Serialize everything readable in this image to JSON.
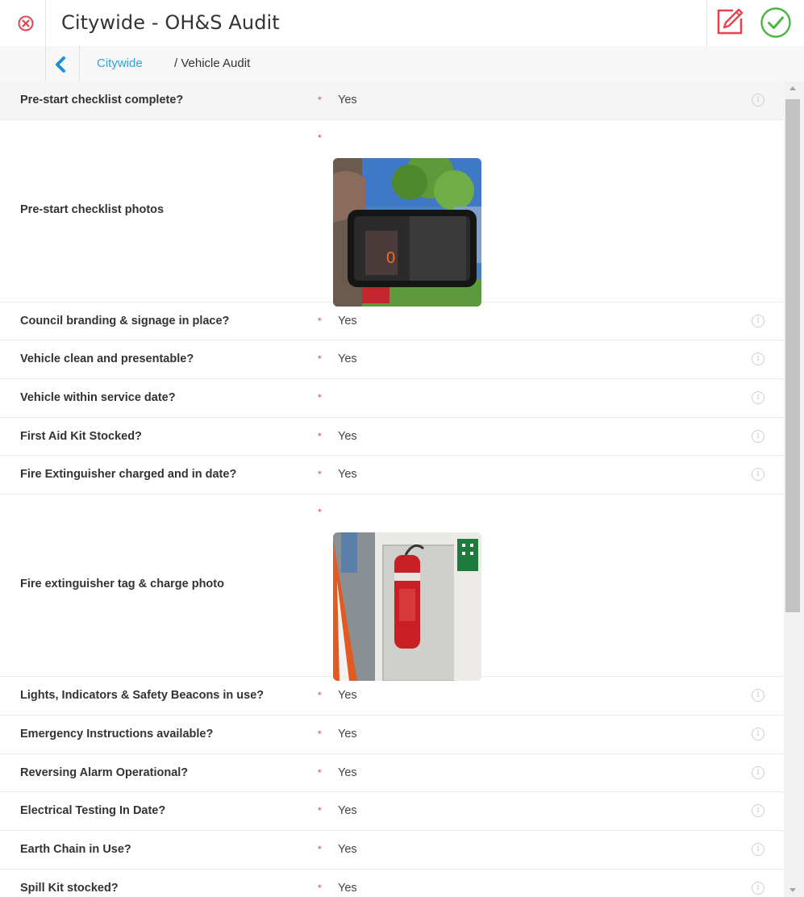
{
  "header": {
    "title": "Citywide - OH&S Audit",
    "close_icon": "close-circle-icon",
    "edit_icon": "edit-pencil-icon",
    "submit_icon": "check-circle-icon"
  },
  "breadcrumb": {
    "back_icon": "chevron-left-icon",
    "link": "Citywide",
    "current": "/ Vehicle Audit"
  },
  "colors": {
    "required": "#e4444f",
    "link": "#2ea3d8",
    "accent_edit": "#e4444f",
    "accent_submit": "#4bb543"
  },
  "rows": [
    {
      "question": "Pre-start checklist complete?",
      "required_mark": "*",
      "answer": "Yes",
      "info": "i"
    },
    {
      "question": "Pre-start checklist photos",
      "required_mark": "*",
      "photo": "phone-screenshot-photo"
    },
    {
      "question": "Council branding & signage in place?",
      "required_mark": "*",
      "answer": "Yes",
      "info": "i"
    },
    {
      "question": "Vehicle clean and presentable?",
      "required_mark": "*",
      "answer": "Yes",
      "info": "i"
    },
    {
      "question": "Vehicle within service date?",
      "required_mark": "*",
      "answer": "",
      "info": "i"
    },
    {
      "question": "First Aid Kit Stocked?",
      "required_mark": "*",
      "answer": "Yes",
      "info": "i"
    },
    {
      "question": "Fire Extinguisher charged and in date?",
      "required_mark": "*",
      "answer": "Yes",
      "info": "i"
    },
    {
      "question": "Fire extinguisher tag & charge photo",
      "required_mark": "*",
      "photo": "fire-extinguisher-photo"
    },
    {
      "question": "Lights, Indicators & Safety Beacons in use?",
      "required_mark": "*",
      "answer": "Yes",
      "info": "i"
    },
    {
      "question": "Emergency Instructions available?",
      "required_mark": "*",
      "answer": "Yes",
      "info": "i"
    },
    {
      "question": "Reversing Alarm Operational?",
      "required_mark": "*",
      "answer": "Yes",
      "info": "i"
    },
    {
      "question": "Electrical Testing In Date?",
      "required_mark": "*",
      "answer": "Yes",
      "info": "i"
    },
    {
      "question": "Earth Chain in Use?",
      "required_mark": "*",
      "answer": "Yes",
      "info": "i"
    },
    {
      "question": "Spill Kit stocked?",
      "required_mark": "*",
      "answer": "Yes",
      "info": "i"
    }
  ]
}
